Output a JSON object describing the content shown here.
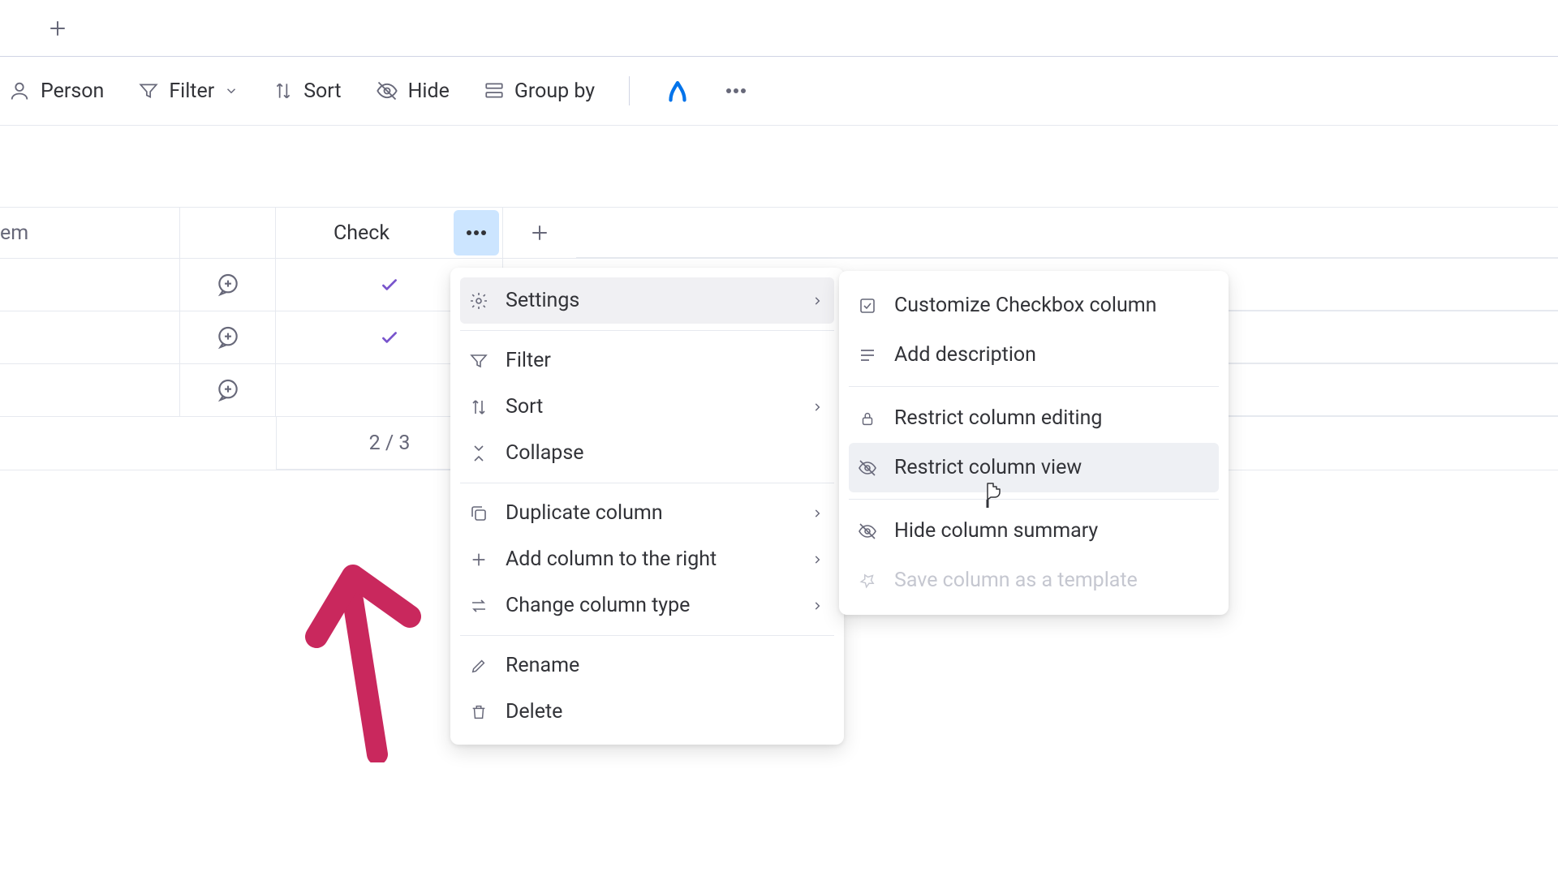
{
  "toolbar": {
    "person": "Person",
    "filter": "Filter",
    "sort": "Sort",
    "hide": "Hide",
    "group_by": "Group by"
  },
  "column": {
    "item_header": "em",
    "check_header": "Check",
    "summary": "2 / 3"
  },
  "menu": {
    "settings": "Settings",
    "filter": "Filter",
    "sort": "Sort",
    "collapse": "Collapse",
    "duplicate": "Duplicate column",
    "add_right": "Add column to the right",
    "change_type": "Change column type",
    "rename": "Rename",
    "delete": "Delete"
  },
  "submenu": {
    "customize": "Customize Checkbox column",
    "add_description": "Add description",
    "restrict_editing": "Restrict column editing",
    "restrict_view": "Restrict column view",
    "hide_summary": "Hide column summary",
    "save_template": "Save column as a template"
  }
}
